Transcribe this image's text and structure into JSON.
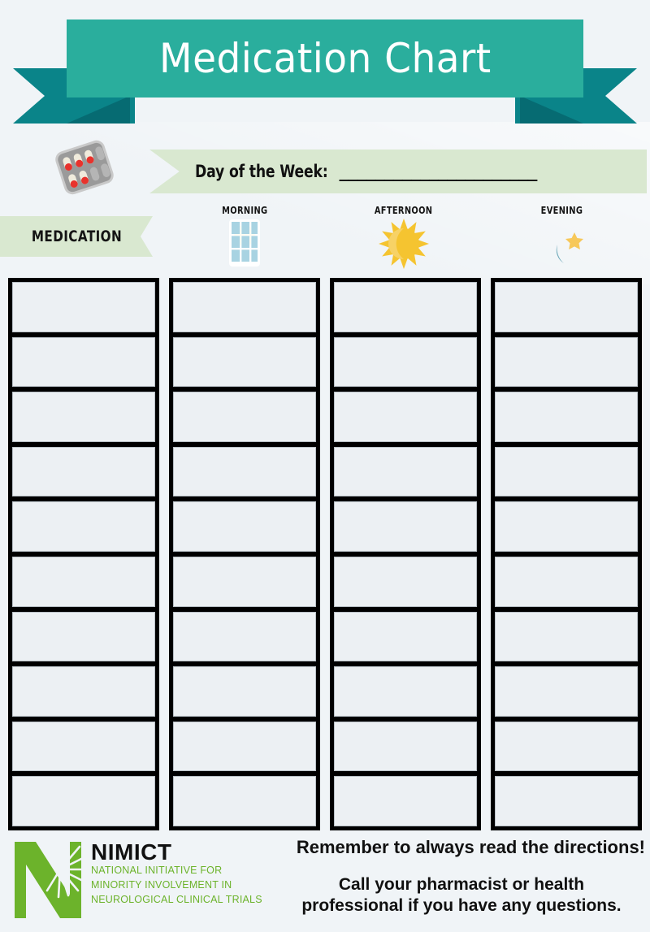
{
  "page": {
    "title": "Medication Chart",
    "background_color": "#f0f4f7"
  },
  "colors": {
    "ribbon": "#2aae9d",
    "ribbon_tail": "#0a8489",
    "ribbon_fold": "#066b72",
    "banner_green": "#d9e8d0",
    "logo_green": "#6cb32b",
    "cell_fill": "#ecf0f3",
    "grid_black": "#000000"
  },
  "header": {
    "ribbon_title": "Medication Chart",
    "pill_icon": "blister-pack-icon"
  },
  "day_field": {
    "label": "Day of the Week:",
    "blank_line": "______________________",
    "value": ""
  },
  "columns": [
    {
      "label": "MEDICATION",
      "icon": ""
    },
    {
      "label": "MORNING",
      "icon": "window-sunrise-icon"
    },
    {
      "label": "AFTERNOON",
      "icon": "sun-icon"
    },
    {
      "label": "EVENING",
      "icon": "moon-star-icon"
    }
  ],
  "table": {
    "row_count": 10,
    "column_count": 4,
    "rows": [
      [
        "",
        "",
        "",
        ""
      ],
      [
        "",
        "",
        "",
        ""
      ],
      [
        "",
        "",
        "",
        ""
      ],
      [
        "",
        "",
        "",
        ""
      ],
      [
        "",
        "",
        "",
        ""
      ],
      [
        "",
        "",
        "",
        ""
      ],
      [
        "",
        "",
        "",
        ""
      ],
      [
        "",
        "",
        "",
        ""
      ],
      [
        "",
        "",
        "",
        ""
      ],
      [
        "",
        "",
        "",
        ""
      ]
    ]
  },
  "footer": {
    "logo": {
      "mark": "nimict-starburst-n-logo",
      "acronym": "NIMICT",
      "subtitle_lines": [
        "NATIONAL INITIATIVE FOR",
        "MINORITY INVOLVEMENT IN",
        "NEUROLOGICAL CLINICAL TRIALS"
      ]
    },
    "notice_primary": "Remember to always read the directions!",
    "notice_secondary_line1": "Call your pharmacist or health",
    "notice_secondary_line2": "professional if you have any questions."
  }
}
